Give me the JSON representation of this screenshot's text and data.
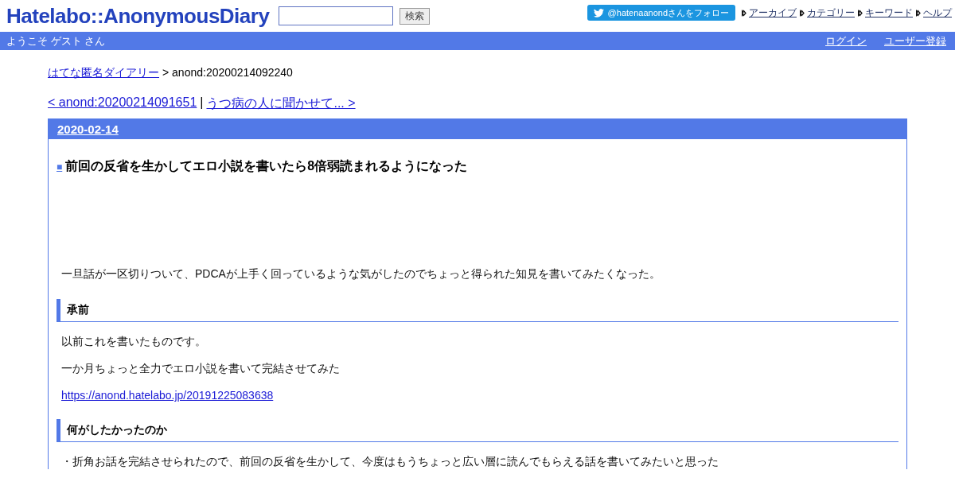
{
  "header": {
    "logo": "Hatelabo::AnonymousDiary",
    "search": {
      "button": "検索"
    },
    "follow_button": "@hatenaanondさんをフォロー",
    "nav_links": [
      "アーカイブ",
      "カテゴリー",
      "キーワード",
      "ヘルプ"
    ]
  },
  "user_bar": {
    "welcome": "ようこそ ゲスト さん",
    "links": [
      "ログイン",
      "ユーザー登録"
    ]
  },
  "breadcrumb": {
    "link": "はてな匿名ダイアリー",
    "current": "> anond:20200214092240"
  },
  "pager": {
    "prev": "< anond:20200214091651",
    "separator": "|",
    "next": "うつ病の人に聞かせて... >"
  },
  "day": {
    "date": "2020-02-14",
    "entry": {
      "marker": "■",
      "title": "前回の反省を生かしてエロ小説を書いたら8倍弱読まれるようになった",
      "blocks": [
        {
          "kind": "paragraph",
          "text": "一旦話が一区切りついて、PDCAが上手く回っているような気がしたのでちょっと得られた知見を書いてみたくなった。"
        },
        {
          "kind": "heading",
          "text": "承前"
        },
        {
          "kind": "paragraph",
          "text": "以前これを書いたものです。"
        },
        {
          "kind": "paragraph",
          "text": "一か月ちょっと全力でエロ小説を書いて完結させてみた"
        },
        {
          "kind": "link",
          "text": "https://anond.hatelabo.jp/20191225083638"
        },
        {
          "kind": "heading",
          "text": "何がしたかったのか"
        },
        {
          "kind": "paragraph",
          "text": "・折角お話を完結させられたので、前回の反省を生かして、今度はもうちょっと広い層に読んでもらえる話を書いてみたいと思った"
        }
      ]
    }
  }
}
